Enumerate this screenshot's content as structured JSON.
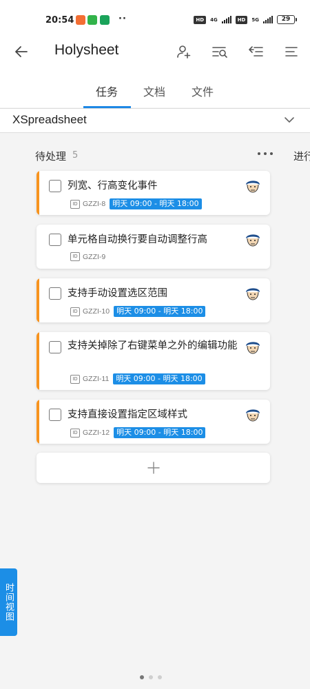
{
  "status_bar": {
    "time": "20:54",
    "dots": "··",
    "hd1": "HD",
    "net1": "4G",
    "hd2": "HD",
    "net2": "5G",
    "battery": "29"
  },
  "app_bar": {
    "title": "Holysheet"
  },
  "tabs": [
    {
      "label": "任务",
      "active": true
    },
    {
      "label": "文档",
      "active": false
    },
    {
      "label": "文件",
      "active": false
    }
  ],
  "project_selector": {
    "value": "XSpreadsheet"
  },
  "column": {
    "title": "待处理",
    "count": "5",
    "next_column_title": "进行"
  },
  "cards": [
    {
      "title": "列宽、行高变化事件",
      "id_label": "ID",
      "code": "GZZI-8",
      "due": "明天 09:00 - 明天 18:00",
      "flagged": true
    },
    {
      "title": "单元格自动换行要自动调整行高",
      "id_label": "ID",
      "code": "GZZI-9",
      "due": "",
      "flagged": false
    },
    {
      "title": "支持手动设置选区范围",
      "id_label": "ID",
      "code": "GZZI-10",
      "due": "明天 09:00 - 明天 18:00",
      "flagged": true
    },
    {
      "title": "支持关掉除了右键菜单之外的编辑功能",
      "id_label": "ID",
      "code": "GZZI-11",
      "due": "明天 09:00 - 明天 18:00",
      "flagged": true
    },
    {
      "title": "支持直接设置指定区域样式",
      "id_label": "ID",
      "code": "GZZI-12",
      "due": "明天 09:00 - 明天 18:00",
      "flagged": true
    }
  ],
  "timeline_button": {
    "label": "时间视图"
  },
  "pager": {
    "pages": 3,
    "current": 1
  },
  "colors": {
    "accent": "#1e88e5",
    "flag": "#f7931e",
    "due_bg": "#1c8ee6"
  }
}
